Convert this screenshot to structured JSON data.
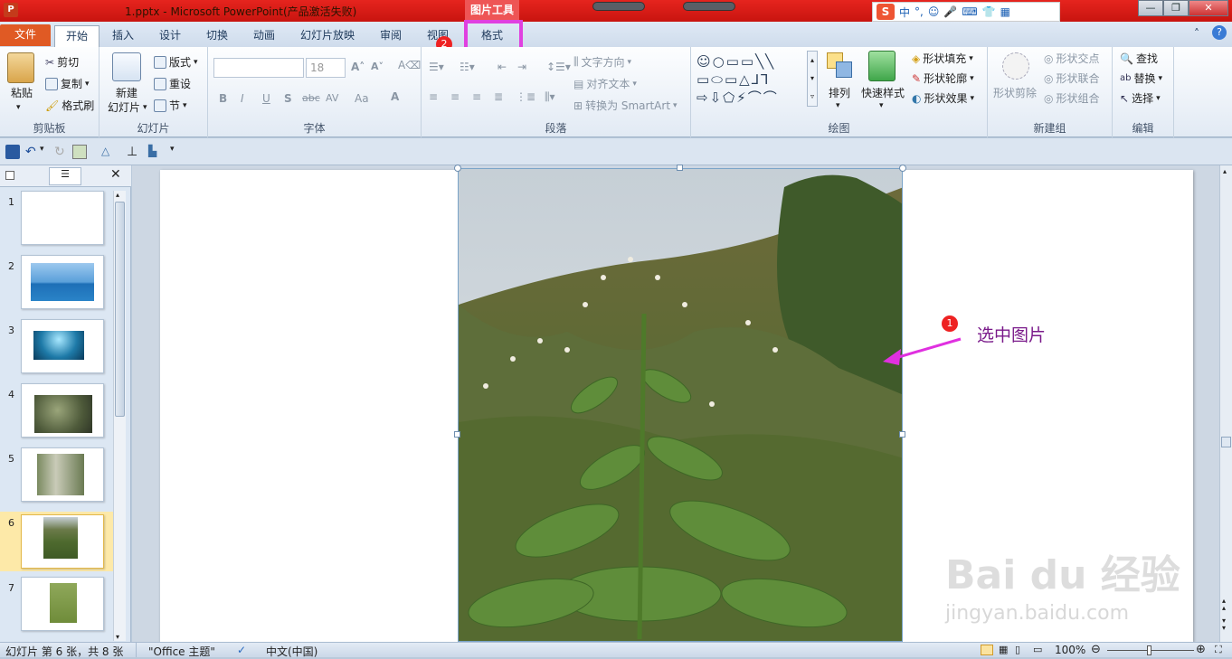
{
  "window": {
    "title": "1.pptx - Microsoft PowerPoint(产品激活失败)",
    "context_label": "图片工具"
  },
  "ime": {
    "logo": "S",
    "items": [
      "中",
      "°,",
      "☺",
      "🎤",
      "⌨",
      "👕",
      "▦"
    ]
  },
  "tabs": [
    "文件",
    "开始",
    "插入",
    "设计",
    "切换",
    "动画",
    "幻灯片放映",
    "审阅",
    "视图",
    "格式"
  ],
  "ribbon": {
    "clipboard": {
      "label": "剪贴板",
      "paste": "粘贴",
      "cut": "剪切",
      "copy": "复制",
      "format_painter": "格式刷"
    },
    "slides": {
      "label": "幻灯片",
      "new_slide_1": "新建",
      "new_slide_2": "幻灯片",
      "layout": "版式",
      "reset": "重设",
      "section": "节"
    },
    "font": {
      "label": "字体",
      "font_size": "18",
      "bold": "B",
      "italic": "I",
      "underline": "U",
      "shadow": "S",
      "strike": "abc",
      "spacing": "AV",
      "case": "Aa",
      "color": "A"
    },
    "paragraph": {
      "label": "段落",
      "text_direction": "文字方向",
      "align_text": "对齐文本",
      "smartart": "转换为 SmartArt"
    },
    "drawing": {
      "label": "绘图",
      "arrange": "排列",
      "quick_styles": "快速样式",
      "fill": "形状填充",
      "outline": "形状轮廓",
      "effects": "形状效果"
    },
    "newgroup": {
      "label": "新建组",
      "crop_shape": "形状剪除",
      "intersect": "形状交点",
      "union": "形状联合",
      "combine": "形状组合"
    },
    "editing": {
      "label": "编辑",
      "find": "查找",
      "replace": "替换",
      "select": "选择"
    }
  },
  "slides": [
    {
      "num": "1",
      "img": "none"
    },
    {
      "num": "2",
      "img": "sky"
    },
    {
      "num": "3",
      "img": "sea"
    },
    {
      "num": "4",
      "img": "tree"
    },
    {
      "num": "5",
      "img": "forest"
    },
    {
      "num": "6",
      "img": "plant"
    },
    {
      "num": "7",
      "img": "green"
    }
  ],
  "selected_slide": "6",
  "annotations": {
    "step1": "1",
    "step1_text": "选中图片",
    "step2": "2"
  },
  "status": {
    "slide_info": "幻灯片 第 6 张，共 8 张",
    "theme": "\"Office 主题\"",
    "language": "中文(中国)",
    "zoom": "100%"
  },
  "watermark": {
    "brand": "Bai du 经验",
    "url": "jingyan.baidu.com"
  }
}
